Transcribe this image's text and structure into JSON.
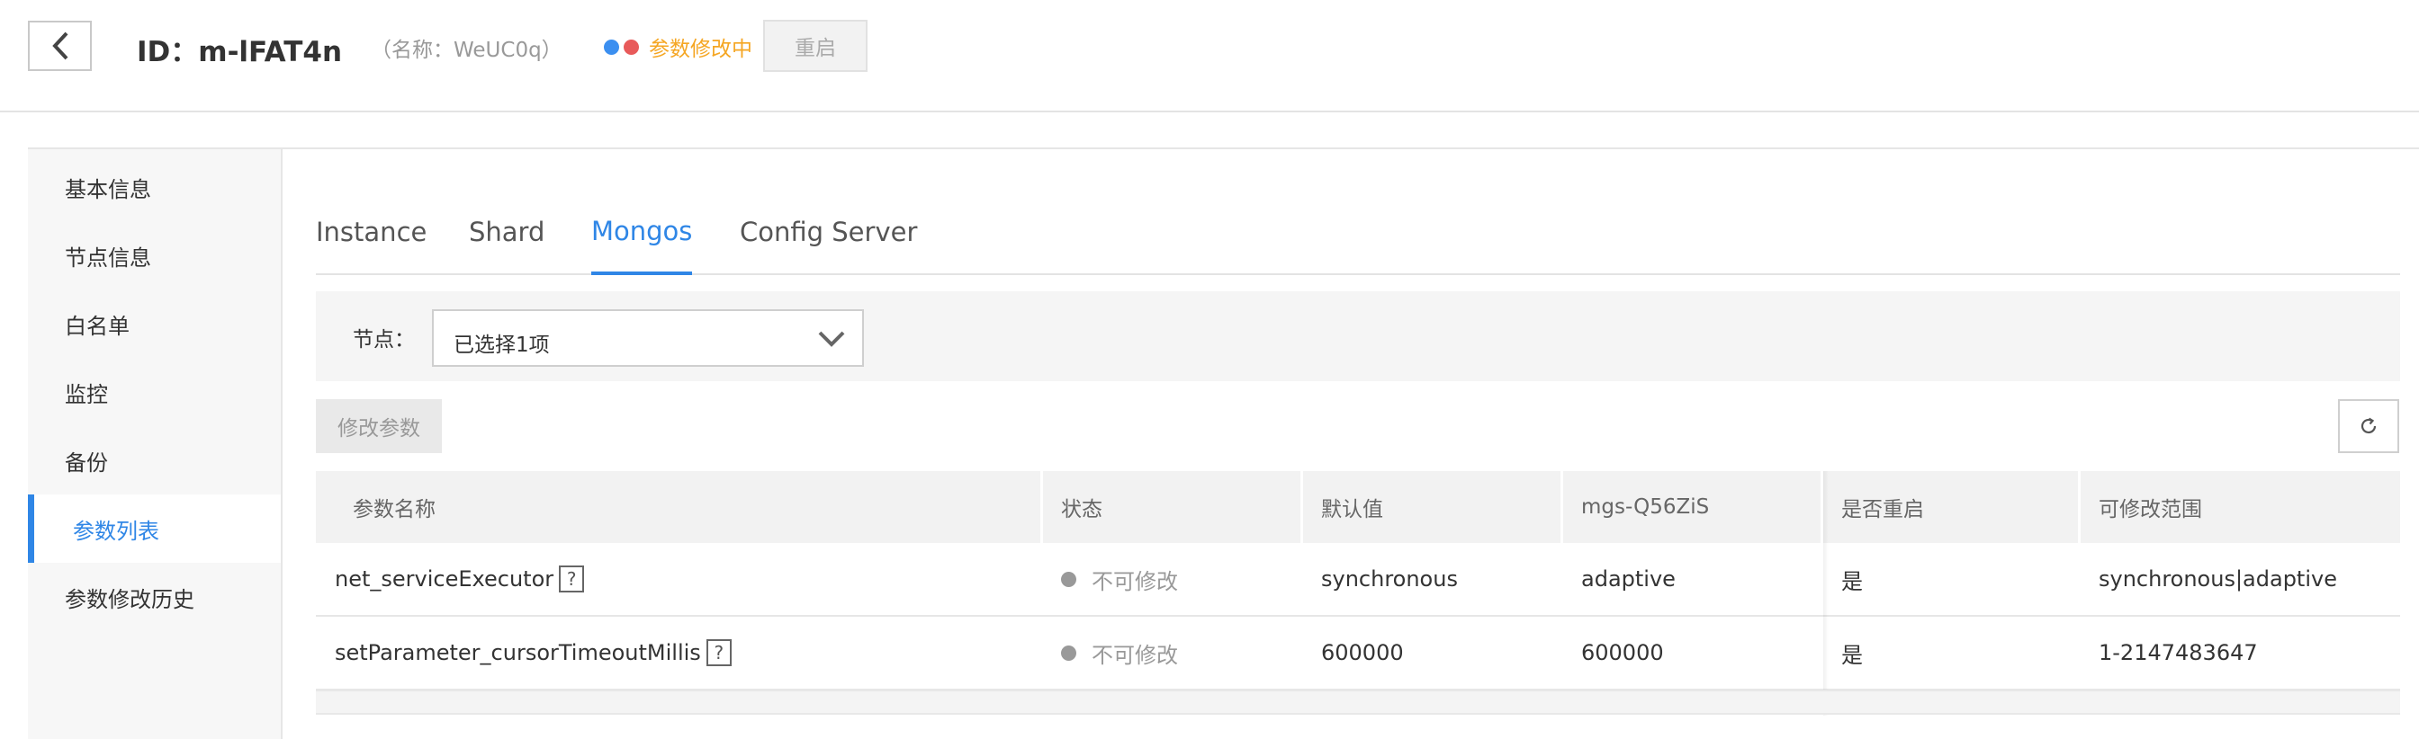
{
  "header": {
    "title": "ID：m-lFAT4n",
    "subname": "（名称：WeUC0q）",
    "status_text": "参数修改中",
    "restart_label": "重启",
    "status_colors": [
      "#3b8ff0",
      "#e85a5a"
    ]
  },
  "sidebar": {
    "items": [
      {
        "label": "基本信息"
      },
      {
        "label": "节点信息"
      },
      {
        "label": "白名单"
      },
      {
        "label": "监控"
      },
      {
        "label": "备份"
      },
      {
        "label": "参数列表"
      },
      {
        "label": "参数修改历史"
      }
    ],
    "active_index": 5
  },
  "tabs": [
    {
      "label": "Instance"
    },
    {
      "label": "Shard"
    },
    {
      "label": "Mongos"
    },
    {
      "label": "Config Server"
    }
  ],
  "active_tab": 2,
  "filter": {
    "label": "节点：",
    "selected": "已选择1项"
  },
  "toolbar": {
    "modify_label": "修改参数"
  },
  "table": {
    "headers": [
      "参数名称",
      "状态",
      "默认值",
      "mgs-Q56ZiS",
      "是否重启",
      "可修改范围"
    ],
    "rows": [
      {
        "name": "net_serviceExecutor",
        "status": "不可修改",
        "default": "synchronous",
        "current": "adaptive",
        "restart": "是",
        "range": "synchronous|adaptive"
      },
      {
        "name": "setParameter_cursorTimeoutMillis",
        "status": "不可修改",
        "default": "600000",
        "current": "600000",
        "restart": "是",
        "range": "1-2147483647"
      }
    ],
    "help_mark": "?"
  },
  "colors": {
    "accent": "#2f86e6",
    "warning": "#f5a623",
    "status_disabled": "#999999"
  }
}
